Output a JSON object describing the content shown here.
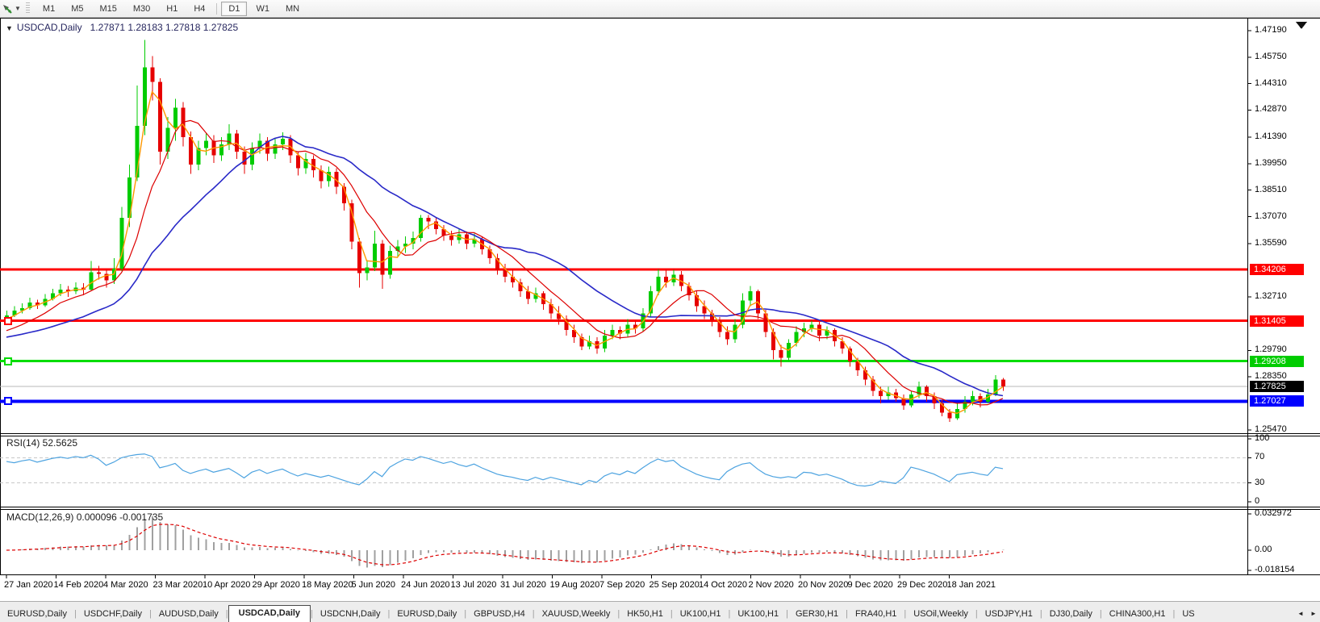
{
  "toolbar": {
    "timeframes": [
      "M1",
      "M5",
      "M15",
      "M30",
      "H1",
      "H4",
      "D1",
      "W1",
      "MN"
    ],
    "active_timeframe": "D1",
    "separator_before": "D1"
  },
  "chart": {
    "title_symbol": "USDCAD,Daily",
    "title_ohlc": "1.27871 1.28183 1.27818 1.27825",
    "colors": {
      "up": "#00CC00",
      "down": "#E60000",
      "ma_fast": "#FF9900",
      "ma_mid": "#DD0000",
      "ma_slow": "#2929C8",
      "current_line": "#B8B8B8",
      "border": "#000000"
    }
  },
  "price_axis": {
    "ticks": [
      "1.47190",
      "1.45750",
      "1.44310",
      "1.42870",
      "1.41390",
      "1.39950",
      "1.38510",
      "1.37070",
      "1.35590",
      "1.32710",
      "1.29790",
      "1.28350",
      "1.25470"
    ],
    "line_labels": [
      {
        "text": "1.34206",
        "bg": "#FF0000",
        "price": 1.34206
      },
      {
        "text": "1.31405",
        "bg": "#FF0000",
        "price": 1.31405
      },
      {
        "text": "1.29208",
        "bg": "#00CC00",
        "price": 1.29208
      },
      {
        "text": "1.27825",
        "bg": "#000000",
        "price": 1.27825
      },
      {
        "text": "1.27027",
        "bg": "#0000FF",
        "price": 1.27027
      }
    ]
  },
  "hlines": [
    {
      "price": 1.34206,
      "color": "#FF0000",
      "width": 3,
      "handle": false
    },
    {
      "price": 1.31405,
      "color": "#FF0000",
      "width": 3,
      "handle": true
    },
    {
      "price": 1.29208,
      "color": "#00DD00",
      "width": 3,
      "handle": true
    },
    {
      "price": 1.27027,
      "color": "#0000FF",
      "width": 4,
      "handle": true
    }
  ],
  "current_price": 1.27825,
  "chart_data": {
    "type": "candlestick",
    "symbol": "USDCAD",
    "timeframe": "Daily",
    "title": "USDCAD,Daily 1.27871 1.28183 1.27818 1.27825",
    "y_axis_range": [
      1.2547,
      1.4719
    ],
    "grid": false,
    "x_dates": [
      "27 Jan 2020",
      "14 Feb 2020",
      "4 Mar 2020",
      "23 Mar 2020",
      "10 Apr 2020",
      "29 Apr 2020",
      "18 May 2020",
      "5 Jun 2020",
      "24 Jun 2020",
      "13 Jul 2020",
      "31 Jul 2020",
      "19 Aug 2020",
      "7 Sep 2020",
      "25 Sep 2020",
      "14 Oct 2020",
      "2 Nov 2020",
      "20 Nov 2020",
      "9 Dec 2020",
      "29 Dec 2020",
      "18 Jan 2021"
    ],
    "candles": [
      [
        1.3145,
        1.3195,
        1.313,
        1.317
      ],
      [
        1.317,
        1.322,
        1.316,
        1.3195
      ],
      [
        1.3195,
        1.3235,
        1.318,
        1.321
      ],
      [
        1.321,
        1.3265,
        1.32,
        1.324
      ],
      [
        1.324,
        1.3255,
        1.3205,
        1.3225
      ],
      [
        1.3225,
        1.3285,
        1.3215,
        1.326
      ],
      [
        1.326,
        1.3315,
        1.325,
        1.329
      ],
      [
        1.329,
        1.334,
        1.3275,
        1.331
      ],
      [
        1.331,
        1.333,
        1.327,
        1.33
      ],
      [
        1.33,
        1.335,
        1.3285,
        1.332
      ],
      [
        1.332,
        1.3345,
        1.328,
        1.331
      ],
      [
        1.331,
        1.3465,
        1.33,
        1.3405
      ],
      [
        1.3405,
        1.344,
        1.3365,
        1.3395
      ],
      [
        1.3395,
        1.342,
        1.332,
        1.336
      ],
      [
        1.336,
        1.348,
        1.334,
        1.3425
      ],
      [
        1.3425,
        1.376,
        1.341,
        1.37
      ],
      [
        1.37,
        1.399,
        1.365,
        1.392
      ],
      [
        1.392,
        1.442,
        1.39,
        1.42
      ],
      [
        1.42,
        1.4669,
        1.415,
        1.452
      ],
      [
        1.452,
        1.458,
        1.434,
        1.444
      ],
      [
        1.444,
        1.446,
        1.399,
        1.406
      ],
      [
        1.406,
        1.425,
        1.402,
        1.419
      ],
      [
        1.419,
        1.4349,
        1.412,
        1.43
      ],
      [
        1.43,
        1.433,
        1.409,
        1.414
      ],
      [
        1.414,
        1.417,
        1.394,
        1.399
      ],
      [
        1.399,
        1.412,
        1.396,
        1.408
      ],
      [
        1.408,
        1.416,
        1.404,
        1.412
      ],
      [
        1.412,
        1.415,
        1.4,
        1.404
      ],
      [
        1.404,
        1.414,
        1.401,
        1.41
      ],
      [
        1.41,
        1.421,
        1.407,
        1.416
      ],
      [
        1.416,
        1.418,
        1.402,
        1.406
      ],
      [
        1.406,
        1.409,
        1.394,
        1.399
      ],
      [
        1.399,
        1.411,
        1.396,
        1.408
      ],
      [
        1.408,
        1.416,
        1.405,
        1.412
      ],
      [
        1.412,
        1.414,
        1.401,
        1.405
      ],
      [
        1.405,
        1.413,
        1.402,
        1.41
      ],
      [
        1.41,
        1.4165,
        1.407,
        1.413
      ],
      [
        1.413,
        1.415,
        1.4,
        1.404
      ],
      [
        1.404,
        1.406,
        1.393,
        1.397
      ],
      [
        1.397,
        1.4055,
        1.394,
        1.402
      ],
      [
        1.402,
        1.404,
        1.392,
        1.396
      ],
      [
        1.396,
        1.3985,
        1.386,
        1.39
      ],
      [
        1.39,
        1.398,
        1.387,
        1.395
      ],
      [
        1.395,
        1.397,
        1.383,
        1.387
      ],
      [
        1.387,
        1.389,
        1.374,
        1.378
      ],
      [
        1.378,
        1.38,
        1.353,
        1.357
      ],
      [
        1.357,
        1.359,
        1.332,
        1.34
      ],
      [
        1.34,
        1.347,
        1.336,
        1.343
      ],
      [
        1.343,
        1.363,
        1.341,
        1.356
      ],
      [
        1.356,
        1.358,
        1.3315,
        1.339
      ],
      [
        1.339,
        1.355,
        1.337,
        1.352
      ],
      [
        1.352,
        1.358,
        1.349,
        1.3545
      ],
      [
        1.3545,
        1.36,
        1.351,
        1.356
      ],
      [
        1.356,
        1.3625,
        1.353,
        1.359
      ],
      [
        1.359,
        1.3716,
        1.357,
        1.37
      ],
      [
        1.37,
        1.3715,
        1.364,
        1.368
      ],
      [
        1.368,
        1.37,
        1.361,
        1.364
      ],
      [
        1.364,
        1.366,
        1.3575,
        1.3605
      ],
      [
        1.3605,
        1.363,
        1.355,
        1.358
      ],
      [
        1.358,
        1.364,
        1.356,
        1.361
      ],
      [
        1.361,
        1.3625,
        1.353,
        1.356
      ],
      [
        1.356,
        1.3615,
        1.354,
        1.3585
      ],
      [
        1.3585,
        1.36,
        1.35,
        1.353
      ],
      [
        1.353,
        1.355,
        1.345,
        1.348
      ],
      [
        1.348,
        1.3505,
        1.339,
        1.3415
      ],
      [
        1.3415,
        1.345,
        1.335,
        1.338
      ],
      [
        1.338,
        1.342,
        1.332,
        1.335
      ],
      [
        1.335,
        1.337,
        1.327,
        1.33
      ],
      [
        1.33,
        1.333,
        1.323,
        1.326
      ],
      [
        1.326,
        1.332,
        1.324,
        1.329
      ],
      [
        1.329,
        1.33,
        1.32,
        1.323
      ],
      [
        1.323,
        1.326,
        1.315,
        1.318
      ],
      [
        1.318,
        1.322,
        1.312,
        1.315
      ],
      [
        1.315,
        1.317,
        1.306,
        1.309
      ],
      [
        1.309,
        1.312,
        1.302,
        1.305
      ],
      [
        1.305,
        1.307,
        1.298,
        1.3
      ],
      [
        1.3,
        1.306,
        1.2985,
        1.303
      ],
      [
        1.303,
        1.305,
        1.296,
        1.299
      ],
      [
        1.299,
        1.309,
        1.297,
        1.306
      ],
      [
        1.306,
        1.312,
        1.304,
        1.309
      ],
      [
        1.309,
        1.311,
        1.304,
        1.307
      ],
      [
        1.307,
        1.315,
        1.305,
        1.312
      ],
      [
        1.312,
        1.314,
        1.307,
        1.31
      ],
      [
        1.31,
        1.321,
        1.308,
        1.318
      ],
      [
        1.318,
        1.333,
        1.316,
        1.33
      ],
      [
        1.33,
        1.342,
        1.328,
        1.338
      ],
      [
        1.338,
        1.342,
        1.332,
        1.335
      ],
      [
        1.335,
        1.3418,
        1.333,
        1.339
      ],
      [
        1.339,
        1.341,
        1.33,
        1.333
      ],
      [
        1.333,
        1.335,
        1.325,
        1.328
      ],
      [
        1.328,
        1.33,
        1.319,
        1.322
      ],
      [
        1.322,
        1.325,
        1.315,
        1.318
      ],
      [
        1.318,
        1.32,
        1.311,
        1.314
      ],
      [
        1.314,
        1.316,
        1.305,
        1.308
      ],
      [
        1.308,
        1.311,
        1.301,
        1.304
      ],
      [
        1.304,
        1.315,
        1.302,
        1.312
      ],
      [
        1.312,
        1.329,
        1.31,
        1.325
      ],
      [
        1.325,
        1.333,
        1.322,
        1.33
      ],
      [
        1.33,
        1.331,
        1.315,
        1.318
      ],
      [
        1.318,
        1.32,
        1.305,
        1.308
      ],
      [
        1.308,
        1.31,
        1.293,
        1.298
      ],
      [
        1.298,
        1.301,
        1.289,
        1.294
      ],
      [
        1.294,
        1.304,
        1.292,
        1.302
      ],
      [
        1.302,
        1.311,
        1.3,
        1.308
      ],
      [
        1.308,
        1.313,
        1.305,
        1.31
      ],
      [
        1.31,
        1.314,
        1.308,
        1.312
      ],
      [
        1.312,
        1.3135,
        1.303,
        1.306
      ],
      [
        1.306,
        1.311,
        1.304,
        1.309
      ],
      [
        1.309,
        1.31,
        1.3,
        1.303
      ],
      [
        1.303,
        1.305,
        1.296,
        1.299
      ],
      [
        1.299,
        1.3,
        1.289,
        1.292
      ],
      [
        1.292,
        1.294,
        1.284,
        1.287
      ],
      [
        1.287,
        1.289,
        1.279,
        1.282
      ],
      [
        1.282,
        1.284,
        1.273,
        1.276
      ],
      [
        1.276,
        1.278,
        1.269,
        1.273
      ],
      [
        1.273,
        1.278,
        1.271,
        1.275
      ],
      [
        1.275,
        1.277,
        1.27,
        1.272
      ],
      [
        1.272,
        1.274,
        1.2655,
        1.268
      ],
      [
        1.268,
        1.276,
        1.267,
        1.274
      ],
      [
        1.274,
        1.281,
        1.272,
        1.278
      ],
      [
        1.278,
        1.279,
        1.27,
        1.273
      ],
      [
        1.273,
        1.275,
        1.266,
        1.269
      ],
      [
        1.269,
        1.271,
        1.262,
        1.264
      ],
      [
        1.264,
        1.266,
        1.259,
        1.261
      ],
      [
        1.261,
        1.269,
        1.26,
        1.266
      ],
      [
        1.266,
        1.273,
        1.264,
        1.27
      ],
      [
        1.27,
        1.276,
        1.268,
        1.273
      ],
      [
        1.273,
        1.2745,
        1.267,
        1.27
      ],
      [
        1.27,
        1.277,
        1.269,
        1.274
      ],
      [
        1.274,
        1.2845,
        1.273,
        1.282
      ],
      [
        1.282,
        1.283,
        1.276,
        1.2783
      ]
    ],
    "rsi_values": [
      64,
      62,
      65,
      67,
      63,
      66,
      69,
      71,
      69,
      72,
      70,
      74,
      68,
      58,
      63,
      70,
      73,
      75,
      76,
      72,
      54,
      57,
      61,
      50,
      45,
      49,
      52,
      47,
      50,
      53,
      46,
      38,
      47,
      51,
      45,
      49,
      52,
      46,
      41,
      45,
      42,
      39,
      42,
      38,
      34,
      30,
      27,
      36,
      48,
      40,
      55,
      62,
      68,
      66,
      72,
      69,
      65,
      61,
      64,
      59,
      56,
      60,
      54,
      49,
      44,
      41,
      39,
      36,
      34,
      39,
      35,
      39,
      36,
      33,
      30,
      27,
      34,
      31,
      41,
      46,
      43,
      49,
      45,
      54,
      62,
      68,
      64,
      66,
      56,
      50,
      44,
      40,
      37,
      35,
      48,
      55,
      60,
      62,
      52,
      44,
      40,
      38,
      40,
      38,
      47,
      46,
      42,
      44,
      40,
      36,
      30,
      26,
      25,
      27,
      33,
      31,
      29,
      38,
      55,
      52,
      48,
      44,
      38,
      32,
      43,
      45,
      47,
      44,
      42,
      55,
      52.6
    ],
    "indicators": {
      "ma_fast_period": 3,
      "ma_fast_seed": 1.314,
      "ma_mid_period": 8,
      "ma_mid_seed": 1.3075,
      "ma_slow_period": 20,
      "ma_slow_seed": 1.3045,
      "macd_fast": 6,
      "macd_slow": 13,
      "macd_signal": 5
    }
  },
  "rsi_panel": {
    "label": "RSI(14) 52.5625",
    "axis_ticks": [
      {
        "text": "100",
        "value": 100
      },
      {
        "text": "70",
        "value": 70
      },
      {
        "text": "30",
        "value": 30
      },
      {
        "text": "0",
        "value": 0
      }
    ],
    "dashed_levels": [
      70,
      30
    ],
    "line_color": "#4DA3E0",
    "level_color": "#C8C8C8"
  },
  "macd_panel": {
    "label": "MACD(12,26,9) 0.000096 -0.001735",
    "axis_ticks": [
      {
        "text": "0.032972",
        "value": 0.032972
      },
      {
        "text": "0.00",
        "value": 0
      },
      {
        "text": "-0.018154",
        "value": -0.018154
      }
    ],
    "hist_color": "#A0A0A0",
    "signal_color": "#DD0000"
  },
  "tabs": {
    "items": [
      {
        "label": "EURUSD,Daily",
        "active": false
      },
      {
        "label": "USDCHF,Daily",
        "active": false
      },
      {
        "label": "AUDUSD,Daily",
        "active": false
      },
      {
        "label": "USDCAD,Daily",
        "active": true
      },
      {
        "label": "USDCNH,Daily",
        "active": false
      },
      {
        "label": "EURUSD,Daily",
        "active": false
      },
      {
        "label": "GBPUSD,H4",
        "active": false
      },
      {
        "label": "XAUUSD,Weekly",
        "active": false
      },
      {
        "label": "HK50,H1",
        "active": false
      },
      {
        "label": "UK100,H1",
        "active": false
      },
      {
        "label": "UK100,H1",
        "active": false
      },
      {
        "label": "GER30,H1",
        "active": false
      },
      {
        "label": "FRA40,H1",
        "active": false
      },
      {
        "label": "USOil,Weekly",
        "active": false
      },
      {
        "label": "USDJPY,H1",
        "active": false
      },
      {
        "label": "DJ30,Daily",
        "active": false
      },
      {
        "label": "CHINA300,H1",
        "active": false
      },
      {
        "label": "US",
        "active": false,
        "truncated": true
      }
    ],
    "scroll_left": "◄",
    "scroll_right": "►"
  }
}
